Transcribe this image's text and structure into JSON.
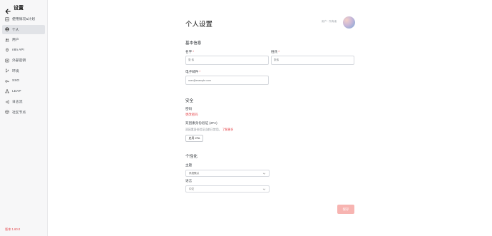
{
  "sidebar": {
    "title": "设置",
    "items": [
      {
        "label": "使用情况&计划",
        "icon": "chart-icon",
        "active": false
      },
      {
        "label": "个人",
        "icon": "user-circle-icon",
        "active": true
      },
      {
        "label": "用户",
        "icon": "users-icon",
        "active": false
      },
      {
        "label": "n8n API",
        "icon": "plug-icon",
        "active": false
      },
      {
        "label": "外部密钥",
        "icon": "vault-icon",
        "active": false
      },
      {
        "label": "环境",
        "icon": "branch-icon",
        "active": false
      },
      {
        "label": "SSO",
        "icon": "key-icon",
        "active": false
      },
      {
        "label": "LDAP",
        "icon": "tree-icon",
        "active": false
      },
      {
        "label": "日志流",
        "icon": "log-in-icon",
        "active": false
      },
      {
        "label": "社区节点",
        "icon": "cube-icon",
        "active": false
      }
    ],
    "version": "版本 1.60.0"
  },
  "header": {
    "title": "个人设置",
    "user_line": "用户 ·  所有者",
    "avatar_icon": "avatar-icon"
  },
  "basic": {
    "title": "基本信息",
    "first_name_label": "名字",
    "first_name_value": "张 伟",
    "last_name_label": "姓氏",
    "last_name_value": "张伟",
    "email_label": "电子邮件",
    "email_value": "user@example.com"
  },
  "security": {
    "title": "安全",
    "password_label": "密码",
    "change_password_link": "更改密码",
    "twofa_title": "双因素身份验证 (2FA)",
    "twofa_desc": "双因素身份验证当前已禁用。",
    "learn_more": "了解更多",
    "enable_2fa_button": "启用 2FA"
  },
  "personalization": {
    "title": "个性化",
    "theme_label": "主题",
    "theme_value": "系统默认",
    "language_label": "语言",
    "language_value": "中文"
  },
  "save_button": "保存",
  "colors": {
    "accent": "#e5484d",
    "save_disabled": "#f7b4b1",
    "sidebar_bg": "#f7f7f8",
    "active_item_bg": "#e1e3e7"
  }
}
